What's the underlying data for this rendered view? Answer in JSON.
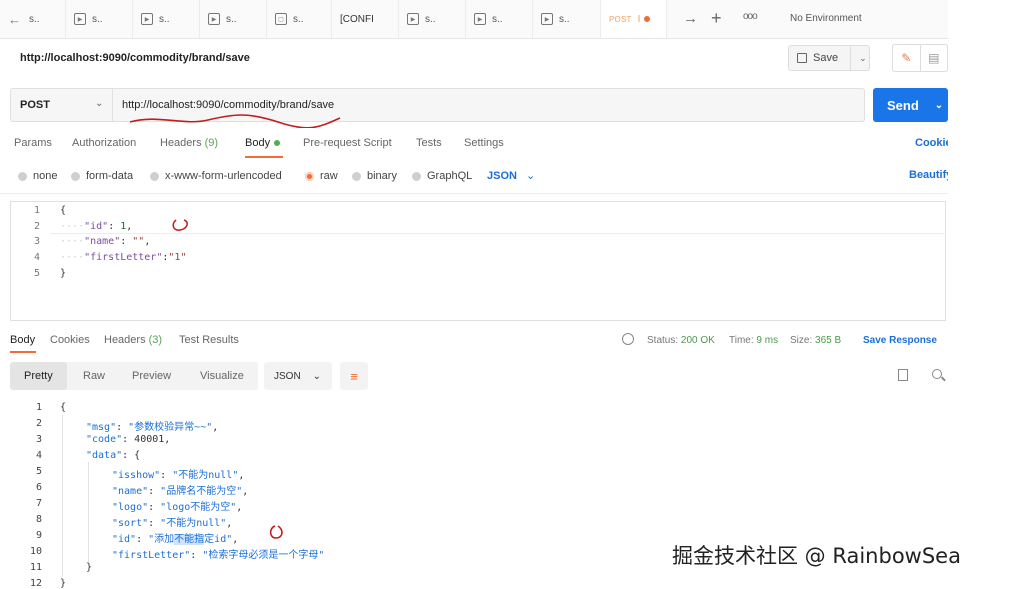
{
  "tabs": [
    {
      "icon": "arrow-left-icon",
      "label": "s.."
    },
    {
      "icon": "play-icon",
      "label": "s.."
    },
    {
      "icon": "play-icon",
      "label": "s.."
    },
    {
      "icon": "play-icon",
      "label": "s.."
    },
    {
      "icon": "doc-icon",
      "label": "s.."
    },
    {
      "icon": "none",
      "label": "[CONFI"
    },
    {
      "icon": "play-icon",
      "label": "s.."
    },
    {
      "icon": "play-icon",
      "label": "s.."
    },
    {
      "icon": "play-icon",
      "label": "s.."
    },
    {
      "method": "POST",
      "label": "I",
      "unsaved": true
    }
  ],
  "environment": "No Environment",
  "request": {
    "title": "http://localhost:9090/commodity/brand/save",
    "save_label": "Save",
    "method": "POST",
    "url": "http://localhost:9090/commodity/brand/save",
    "send_label": "Send",
    "tabs": {
      "params": "Params",
      "authorization": "Authorization",
      "headers": "Headers",
      "headers_count": "(9)",
      "body": "Body",
      "prerequest": "Pre-request Script",
      "tests": "Tests",
      "settings": "Settings"
    },
    "cookies": "Cookie",
    "body_types": [
      "none",
      "form-data",
      "x-www-form-urlencoded",
      "raw",
      "binary",
      "GraphQL"
    ],
    "body_type_selected": "raw",
    "format": "JSON",
    "beautify": "Beautify",
    "body_lines": {
      "l1": "{",
      "l2_key": "\"id\"",
      "l2_val": "1",
      "l3_key": "\"name\"",
      "l3_val": "\"\"",
      "l4_key": "\"firstLetter\"",
      "l4_val": "\"1\"",
      "l5": "}"
    }
  },
  "response": {
    "tabs": {
      "body": "Body",
      "cookies": "Cookies",
      "headers": "Headers",
      "headers_count": "(3)",
      "test_results": "Test Results"
    },
    "status_label": "Status:",
    "status_value": "200 OK",
    "time_label": "Time:",
    "time_value": "9 ms",
    "size_label": "Size:",
    "size_value": "365 B",
    "save_response": "Save Response",
    "views": {
      "pretty": "Pretty",
      "raw": "Raw",
      "preview": "Preview",
      "visualize": "Visualize"
    },
    "format": "JSON",
    "lines": {
      "l1": "{",
      "msg_key": "\"msg\"",
      "msg_val": "\"参数校验异常~~\"",
      "code_key": "\"code\"",
      "code_val": "40001",
      "data_key": "\"data\"",
      "data_open": "{",
      "isshow_key": "\"isshow\"",
      "isshow_val": "\"不能为null\"",
      "name_key": "\"name\"",
      "name_val": "\"品牌名不能为空\"",
      "logo_key": "\"logo\"",
      "logo_val": "\"logo不能为空\"",
      "sort_key": "\"sort\"",
      "sort_val": "\"不能为null\"",
      "id_key": "\"id\"",
      "id_val_a": "\"添加",
      "id_val_hl": "不能指",
      "id_val_b": "定id\"",
      "fl_key": "\"firstLetter\"",
      "fl_val": "\"检索字母必须是一个字母\"",
      "l11": "}",
      "l12": "}"
    }
  },
  "watermark": "掘金技术社区 @ RainbowSea"
}
